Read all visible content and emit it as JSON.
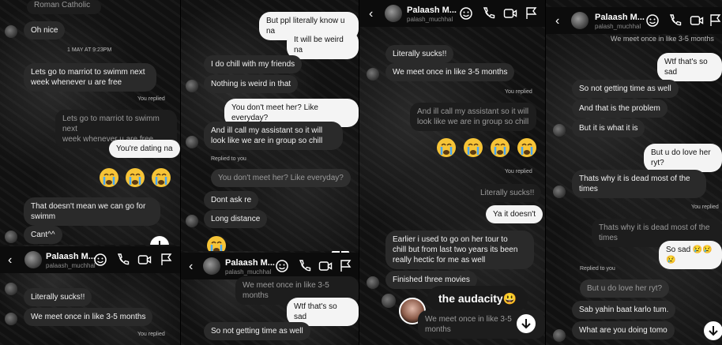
{
  "p1": {
    "m0": "Roman Catholic",
    "m1": "Oh nice",
    "ts": "1 MAY AT 9:23PM",
    "m2": "Lets go to marriot to swimm next\nweek whenever u are free",
    "replied": "You replied",
    "q1": "Lets go to marriot to swimm next\nweek whenever u are free",
    "m3": "You're dating na",
    "m4": "That doesn't mean we can go for\nswimm",
    "m5": "Cant^^"
  },
  "p1b": {
    "name": "Palaash M...",
    "handle": "palaash_muchhal",
    "m1": "Literally sucks!!",
    "m2": "We meet  once in like 3-5 months",
    "replied": "You replied"
  },
  "p2": {
    "m1": "But ppl literally know u na",
    "m2": "It will be weird na",
    "m3": "I do chill with my friends",
    "m4": "Nothing is weird in that",
    "m5": "You don't meet her? Like everyday?",
    "m6": "And ill call my assistant so it will\nlook like we are in group so chill",
    "replied": "Replied to you",
    "q1": "You don't meet her? Like everyday?",
    "m7": "Dont ask re",
    "m8": "Long distance"
  },
  "p2b": {
    "name": "Palaash M...",
    "handle": "palash_muchhal",
    "q1": "We meet  once in like 3-5 months",
    "m1": "Wtf that's so sad",
    "m2": "So not getting time as well"
  },
  "p3": {
    "name": "Palaash M...",
    "handle": "palash_muchhal",
    "m1": "Literally sucks!!",
    "m2": "We meet  once in like 3-5 months",
    "replied": "You replied",
    "q1": "And ill call my assistant so it will\nlook like we are in group so chill",
    "replied2": "You replied",
    "q2": "Literally sucks!!",
    "m3": "Ya it doesn't",
    "m4": "Earlier i used to go on her tour to\nchill but from last two years its been\nreally hectic for me as well",
    "m5": "Finished three movies",
    "caption": "the audacity😃",
    "q3": "We meet  once in like 3-5 months"
  },
  "p4": {
    "name": "Palaash M...",
    "handle": "palash_muchhal",
    "q0": "We meet  once in like 3-5 months",
    "m1": "Wtf that's so sad",
    "m2": "So not getting time as well",
    "m3": "And that is the problem",
    "m4": "But it is what it is",
    "m5": "But u do love her ryt?",
    "m6": "Thats why it is dead most of the\ntimes",
    "replied": "You replied",
    "q1": "Thats why it is dead most of the times",
    "m7": "So sad 😢😢😢",
    "replied2": "Replied to you",
    "q2": "But u do love her ryt?",
    "m8": "Sab yahin baat karlo tum.",
    "m9": "What are you doing tomo"
  },
  "icons": [
    "back-arrow-icon",
    "emoji-sticker-icon",
    "phone-icon",
    "video-icon",
    "flag-icon",
    "scroll-down-icon"
  ]
}
